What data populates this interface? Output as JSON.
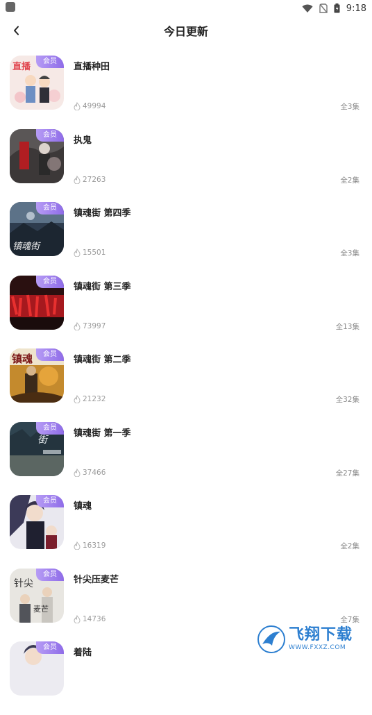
{
  "status_bar": {
    "time": "9:18"
  },
  "header": {
    "title": "今日更新"
  },
  "badge_label": "会员",
  "items": [
    {
      "name": "直播种田",
      "hot": "49994",
      "episodes": "全3集"
    },
    {
      "name": "执鬼",
      "hot": "27263",
      "episodes": "全2集"
    },
    {
      "name": "镇魂街 第四季",
      "hot": "15501",
      "episodes": "全3集"
    },
    {
      "name": "镇魂街 第三季",
      "hot": "73997",
      "episodes": "全13集"
    },
    {
      "name": "镇魂街 第二季",
      "hot": "21232",
      "episodes": "全32集"
    },
    {
      "name": "镇魂街 第一季",
      "hot": "37466",
      "episodes": "全27集"
    },
    {
      "name": "镇魂",
      "hot": "16319",
      "episodes": "全2集"
    },
    {
      "name": "针尖压麦芒",
      "hot": "14736",
      "episodes": "全7集"
    },
    {
      "name": "着陆",
      "hot": "",
      "episodes": ""
    }
  ],
  "watermark": {
    "title": "飞翔下载",
    "url": "WWW.FXXZ.COM"
  },
  "colors": {
    "accent": "#9b7cf0",
    "badge_start": "#b69cf5",
    "badge_end": "#8f6ce8"
  }
}
